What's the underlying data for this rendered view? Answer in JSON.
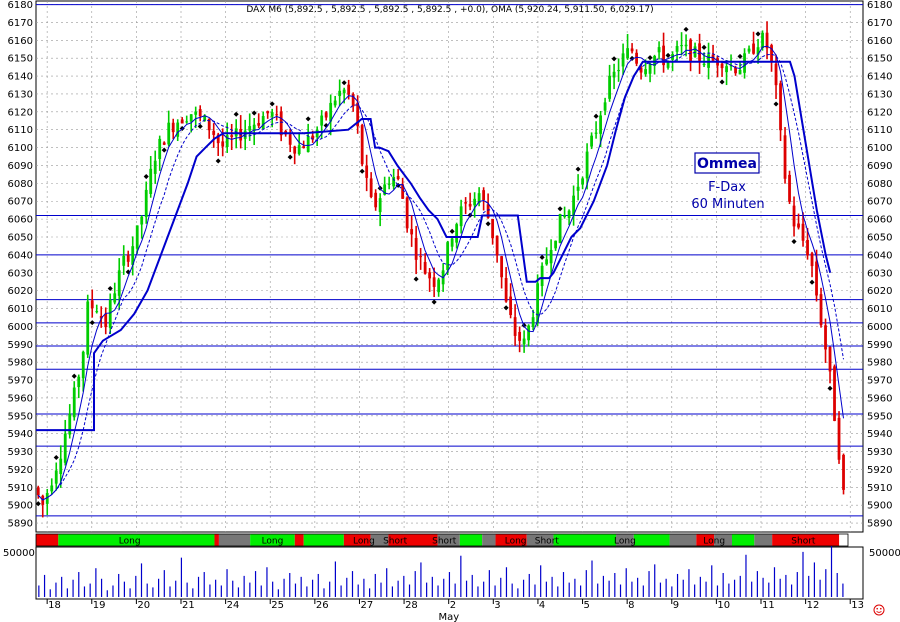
{
  "header": {
    "title": "DAX M6 (5,892.5 , 5,892.5 , 5,892.5 , 5,892.5 , +0.0), OMA (5,920.24, 5,911.50, 6,029.17)"
  },
  "watermark": {
    "name": "Ommea",
    "line1": "F-Dax",
    "line2": "60 Minuten"
  },
  "colors": {
    "up": "#00cc00",
    "down": "#dd0000",
    "neutral": "#777777",
    "line": "#0000cc",
    "long_band": "#00ee00",
    "short_band": "#ee0000",
    "grid": "#999999"
  },
  "chart_data": {
    "type": "candlestick",
    "title": "DAX M6 (5,892.5 , 5,892.5 , 5,892.5 , 5,892.5 , +0.0), OMA (5,920.24, 5,911.50, 6,029.17)",
    "ylim": [
      5885,
      6182
    ],
    "yticks": [
      5890,
      5900,
      5910,
      5920,
      5930,
      5940,
      5950,
      5960,
      5970,
      5980,
      5990,
      6000,
      6010,
      6020,
      6030,
      6040,
      6050,
      6060,
      6070,
      6080,
      6090,
      6100,
      6110,
      6120,
      6130,
      6140,
      6150,
      6160,
      6170,
      6180
    ],
    "xlim": [
      0,
      18.2
    ],
    "x_ticks": [
      {
        "x": 0.25,
        "label": "18"
      },
      {
        "x": 1.25,
        "label": "19"
      },
      {
        "x": 2.25,
        "label": "20"
      },
      {
        "x": 3.25,
        "label": "21"
      },
      {
        "x": 4.25,
        "label": "24"
      },
      {
        "x": 5.25,
        "label": "25"
      },
      {
        "x": 6.25,
        "label": "26"
      },
      {
        "x": 7.25,
        "label": "27"
      },
      {
        "x": 8.25,
        "label": "28"
      },
      {
        "x": 9.25,
        "label": "2"
      },
      {
        "x": 10.25,
        "label": "3"
      },
      {
        "x": 11.25,
        "label": "4"
      },
      {
        "x": 12.25,
        "label": "5"
      },
      {
        "x": 13.25,
        "label": "8"
      },
      {
        "x": 14.25,
        "label": "9"
      },
      {
        "x": 15.25,
        "label": "10"
      },
      {
        "x": 16.25,
        "label": "11"
      },
      {
        "x": 17.25,
        "label": "12"
      },
      {
        "x": 18.25,
        "label": "13"
      }
    ],
    "month_label": {
      "x": 9.0,
      "label": "May"
    },
    "horizontal_levels": [
      6180,
      6062,
      6040,
      6015,
      6002,
      5989,
      5976,
      5951,
      5933,
      5894
    ],
    "price_path": [
      [
        0,
        5910
      ],
      [
        0.2,
        5900
      ],
      [
        0.4,
        5915
      ],
      [
        0.6,
        5930
      ],
      [
        0.9,
        5960
      ],
      [
        1.1,
        5985
      ],
      [
        1.2,
        6010
      ],
      [
        1.4,
        6012
      ],
      [
        1.6,
        6000
      ],
      [
        1.8,
        6020
      ],
      [
        2.0,
        6035
      ],
      [
        2.3,
        6050
      ],
      [
        2.5,
        6070
      ],
      [
        2.7,
        6095
      ],
      [
        3.0,
        6110
      ],
      [
        3.2,
        6115
      ],
      [
        3.5,
        6120
      ],
      [
        3.8,
        6115
      ],
      [
        4.0,
        6110
      ],
      [
        4.2,
        6100
      ],
      [
        4.5,
        6105
      ],
      [
        4.8,
        6112
      ],
      [
        5.0,
        6115
      ],
      [
        5.3,
        6120
      ],
      [
        5.6,
        6108
      ],
      [
        5.9,
        6100
      ],
      [
        6.2,
        6105
      ],
      [
        6.5,
        6115
      ],
      [
        6.8,
        6130
      ],
      [
        7.0,
        6132
      ],
      [
        7.2,
        6120
      ],
      [
        7.4,
        6085
      ],
      [
        7.6,
        6065
      ],
      [
        7.8,
        6075
      ],
      [
        8.0,
        6085
      ],
      [
        8.2,
        6080
      ],
      [
        8.4,
        6055
      ],
      [
        8.6,
        6040
      ],
      [
        8.8,
        6030
      ],
      [
        9.0,
        6025
      ],
      [
        9.2,
        6035
      ],
      [
        9.4,
        6055
      ],
      [
        9.6,
        6065
      ],
      [
        9.8,
        6070
      ],
      [
        10.0,
        6075
      ],
      [
        10.2,
        6060
      ],
      [
        10.4,
        6040
      ],
      [
        10.6,
        6010
      ],
      [
        10.8,
        5995
      ],
      [
        11.0,
        5990
      ],
      [
        11.2,
        6010
      ],
      [
        11.4,
        6030
      ],
      [
        11.6,
        6048
      ],
      [
        11.8,
        6058
      ],
      [
        12.0,
        6065
      ],
      [
        12.2,
        6080
      ],
      [
        12.4,
        6095
      ],
      [
        12.6,
        6110
      ],
      [
        12.8,
        6130
      ],
      [
        13.0,
        6140
      ],
      [
        13.2,
        6150
      ],
      [
        13.4,
        6155
      ],
      [
        13.6,
        6145
      ],
      [
        13.8,
        6150
      ],
      [
        14.0,
        6152
      ],
      [
        14.2,
        6148
      ],
      [
        14.5,
        6155
      ],
      [
        14.8,
        6152
      ],
      [
        15.0,
        6150
      ],
      [
        15.2,
        6148
      ],
      [
        15.4,
        6150
      ],
      [
        15.6,
        6146
      ],
      [
        15.8,
        6145
      ],
      [
        16.0,
        6150
      ],
      [
        16.2,
        6160
      ],
      [
        16.4,
        6160
      ],
      [
        16.6,
        6140
      ],
      [
        16.8,
        6090
      ],
      [
        17.0,
        6060
      ],
      [
        17.2,
        6050
      ],
      [
        17.4,
        6040
      ],
      [
        17.6,
        6010
      ],
      [
        17.8,
        5980
      ],
      [
        17.95,
        5950
      ],
      [
        18.1,
        5920
      ],
      [
        18.2,
        5892
      ]
    ],
    "stop_line": [
      [
        0,
        5942
      ],
      [
        1.3,
        5942
      ],
      [
        1.3,
        5985
      ],
      [
        1.5,
        5992
      ],
      [
        1.9,
        5998
      ],
      [
        2.2,
        6007
      ],
      [
        2.5,
        6020
      ],
      [
        2.8,
        6040
      ],
      [
        3.1,
        6060
      ],
      [
        3.4,
        6080
      ],
      [
        3.6,
        6095
      ],
      [
        3.8,
        6100
      ],
      [
        4.0,
        6105
      ],
      [
        4.2,
        6108
      ],
      [
        4.5,
        6108
      ],
      [
        5.0,
        6108
      ],
      [
        6.0,
        6108
      ],
      [
        7.0,
        6110
      ],
      [
        7.3,
        6116
      ],
      [
        7.5,
        6116
      ],
      [
        7.6,
        6100
      ],
      [
        7.7,
        6100
      ],
      [
        7.9,
        6098
      ],
      [
        8.1,
        6090
      ],
      [
        8.4,
        6080
      ],
      [
        8.6,
        6072
      ],
      [
        8.8,
        6065
      ],
      [
        9.0,
        6060
      ],
      [
        9.2,
        6050
      ],
      [
        9.7,
        6050
      ],
      [
        9.9,
        6050
      ],
      [
        10.0,
        6062
      ],
      [
        10.4,
        6062
      ],
      [
        10.6,
        6062
      ],
      [
        10.8,
        6062
      ],
      [
        11.0,
        6025
      ],
      [
        11.2,
        6025
      ],
      [
        11.3,
        6027
      ],
      [
        11.5,
        6027
      ],
      [
        11.6,
        6030
      ],
      [
        11.8,
        6040
      ],
      [
        12.0,
        6050
      ],
      [
        12.2,
        6055
      ],
      [
        12.5,
        6070
      ],
      [
        12.8,
        6090
      ],
      [
        13.0,
        6110
      ],
      [
        13.2,
        6128
      ],
      [
        13.4,
        6140
      ],
      [
        13.6,
        6148
      ],
      [
        14.0,
        6148
      ],
      [
        15.0,
        6148
      ],
      [
        16.0,
        6148
      ],
      [
        16.5,
        6148
      ],
      [
        16.9,
        6148
      ],
      [
        17.0,
        6140
      ],
      [
        17.2,
        6110
      ],
      [
        17.5,
        6065
      ],
      [
        17.7,
        6040
      ],
      [
        17.8,
        6030
      ]
    ],
    "regime_segments": [
      {
        "start": 0.0,
        "end": 0.5,
        "state": "short"
      },
      {
        "start": 0.5,
        "end": 4.0,
        "state": "long"
      },
      {
        "start": 4.0,
        "end": 4.1,
        "state": "short"
      },
      {
        "start": 4.1,
        "end": 4.8,
        "state": "neutral"
      },
      {
        "start": 4.8,
        "end": 5.8,
        "state": "long"
      },
      {
        "start": 5.8,
        "end": 6.0,
        "state": "short"
      },
      {
        "start": 6.0,
        "end": 6.9,
        "state": "long"
      },
      {
        "start": 6.9,
        "end": 7.5,
        "state": "short"
      },
      {
        "start": 7.5,
        "end": 7.9,
        "state": "neutral"
      },
      {
        "start": 7.9,
        "end": 9.0,
        "state": "short"
      },
      {
        "start": 9.0,
        "end": 9.5,
        "state": "neutral"
      },
      {
        "start": 9.5,
        "end": 10.0,
        "state": "long"
      },
      {
        "start": 10.0,
        "end": 10.3,
        "state": "neutral"
      },
      {
        "start": 10.3,
        "end": 11.0,
        "state": "short"
      },
      {
        "start": 11.0,
        "end": 11.6,
        "state": "neutral"
      },
      {
        "start": 11.6,
        "end": 13.0,
        "state": "long"
      },
      {
        "start": 13.0,
        "end": 13.4,
        "state": "neutral"
      },
      {
        "start": 13.4,
        "end": 14.2,
        "state": "long"
      },
      {
        "start": 14.2,
        "end": 14.8,
        "state": "neutral"
      },
      {
        "start": 14.8,
        "end": 15.2,
        "state": "short"
      },
      {
        "start": 15.2,
        "end": 15.6,
        "state": "neutral"
      },
      {
        "start": 15.6,
        "end": 16.1,
        "state": "long"
      },
      {
        "start": 16.1,
        "end": 16.5,
        "state": "neutral"
      },
      {
        "start": 16.5,
        "end": 18.0,
        "state": "short"
      }
    ],
    "regime_labels": [
      {
        "x": 2.1,
        "text": "Long"
      },
      {
        "x": 5.3,
        "text": "Long"
      },
      {
        "x": 7.35,
        "text": "Long"
      },
      {
        "x": 8.05,
        "text": "Short"
      },
      {
        "x": 9.15,
        "text": "Short"
      },
      {
        "x": 10.75,
        "text": "Long"
      },
      {
        "x": 11.45,
        "text": "Short"
      },
      {
        "x": 13.2,
        "text": "Long"
      },
      {
        "x": 15.2,
        "text": "Long"
      },
      {
        "x": 17.2,
        "text": "Short"
      }
    ],
    "volume": {
      "ymax": 50000,
      "ytick_label": "50000",
      "values": [
        12000,
        23000,
        8000,
        15000,
        21000,
        9000,
        18000,
        26000,
        11000,
        14000,
        30000,
        19000,
        7000,
        12000,
        24000,
        16000,
        9000,
        22000,
        35000,
        14000,
        10000,
        19000,
        28000,
        11000,
        17000,
        41000,
        15000,
        9000,
        21000,
        26000,
        13000,
        18000,
        12000,
        29000,
        17000,
        10000,
        22000,
        15000,
        27000,
        12000,
        31000,
        16000,
        8000,
        19000,
        25000,
        14000,
        21000,
        11000,
        18000,
        24000,
        9000,
        16000,
        37000,
        12000,
        20000,
        27000,
        13000,
        19000,
        9000,
        24000,
        15000,
        30000,
        11000,
        17000,
        22000,
        13000,
        27000,
        36000,
        15000,
        21000,
        12000,
        19000,
        26000,
        14000,
        43000,
        17000,
        23000,
        11000,
        16000,
        28000,
        12000,
        20000,
        31000,
        14000,
        9000,
        18000,
        24000,
        13000,
        33000,
        16000,
        21000,
        11000,
        26000,
        15000,
        19000,
        12000,
        28000,
        38000,
        14000,
        22000,
        17000,
        25000,
        13000,
        30000,
        16000,
        20000,
        12000,
        27000,
        34000,
        15000,
        19000,
        11000,
        24000,
        18000,
        29000,
        13000,
        21000,
        16000,
        33000,
        12000,
        25000,
        14000,
        18000,
        22000,
        44000,
        16000,
        27000,
        20000,
        15000,
        31000,
        19000,
        23000,
        13000,
        26000,
        47000,
        22000,
        36000,
        18000,
        29000,
        53000,
        25000,
        14000
      ]
    }
  }
}
